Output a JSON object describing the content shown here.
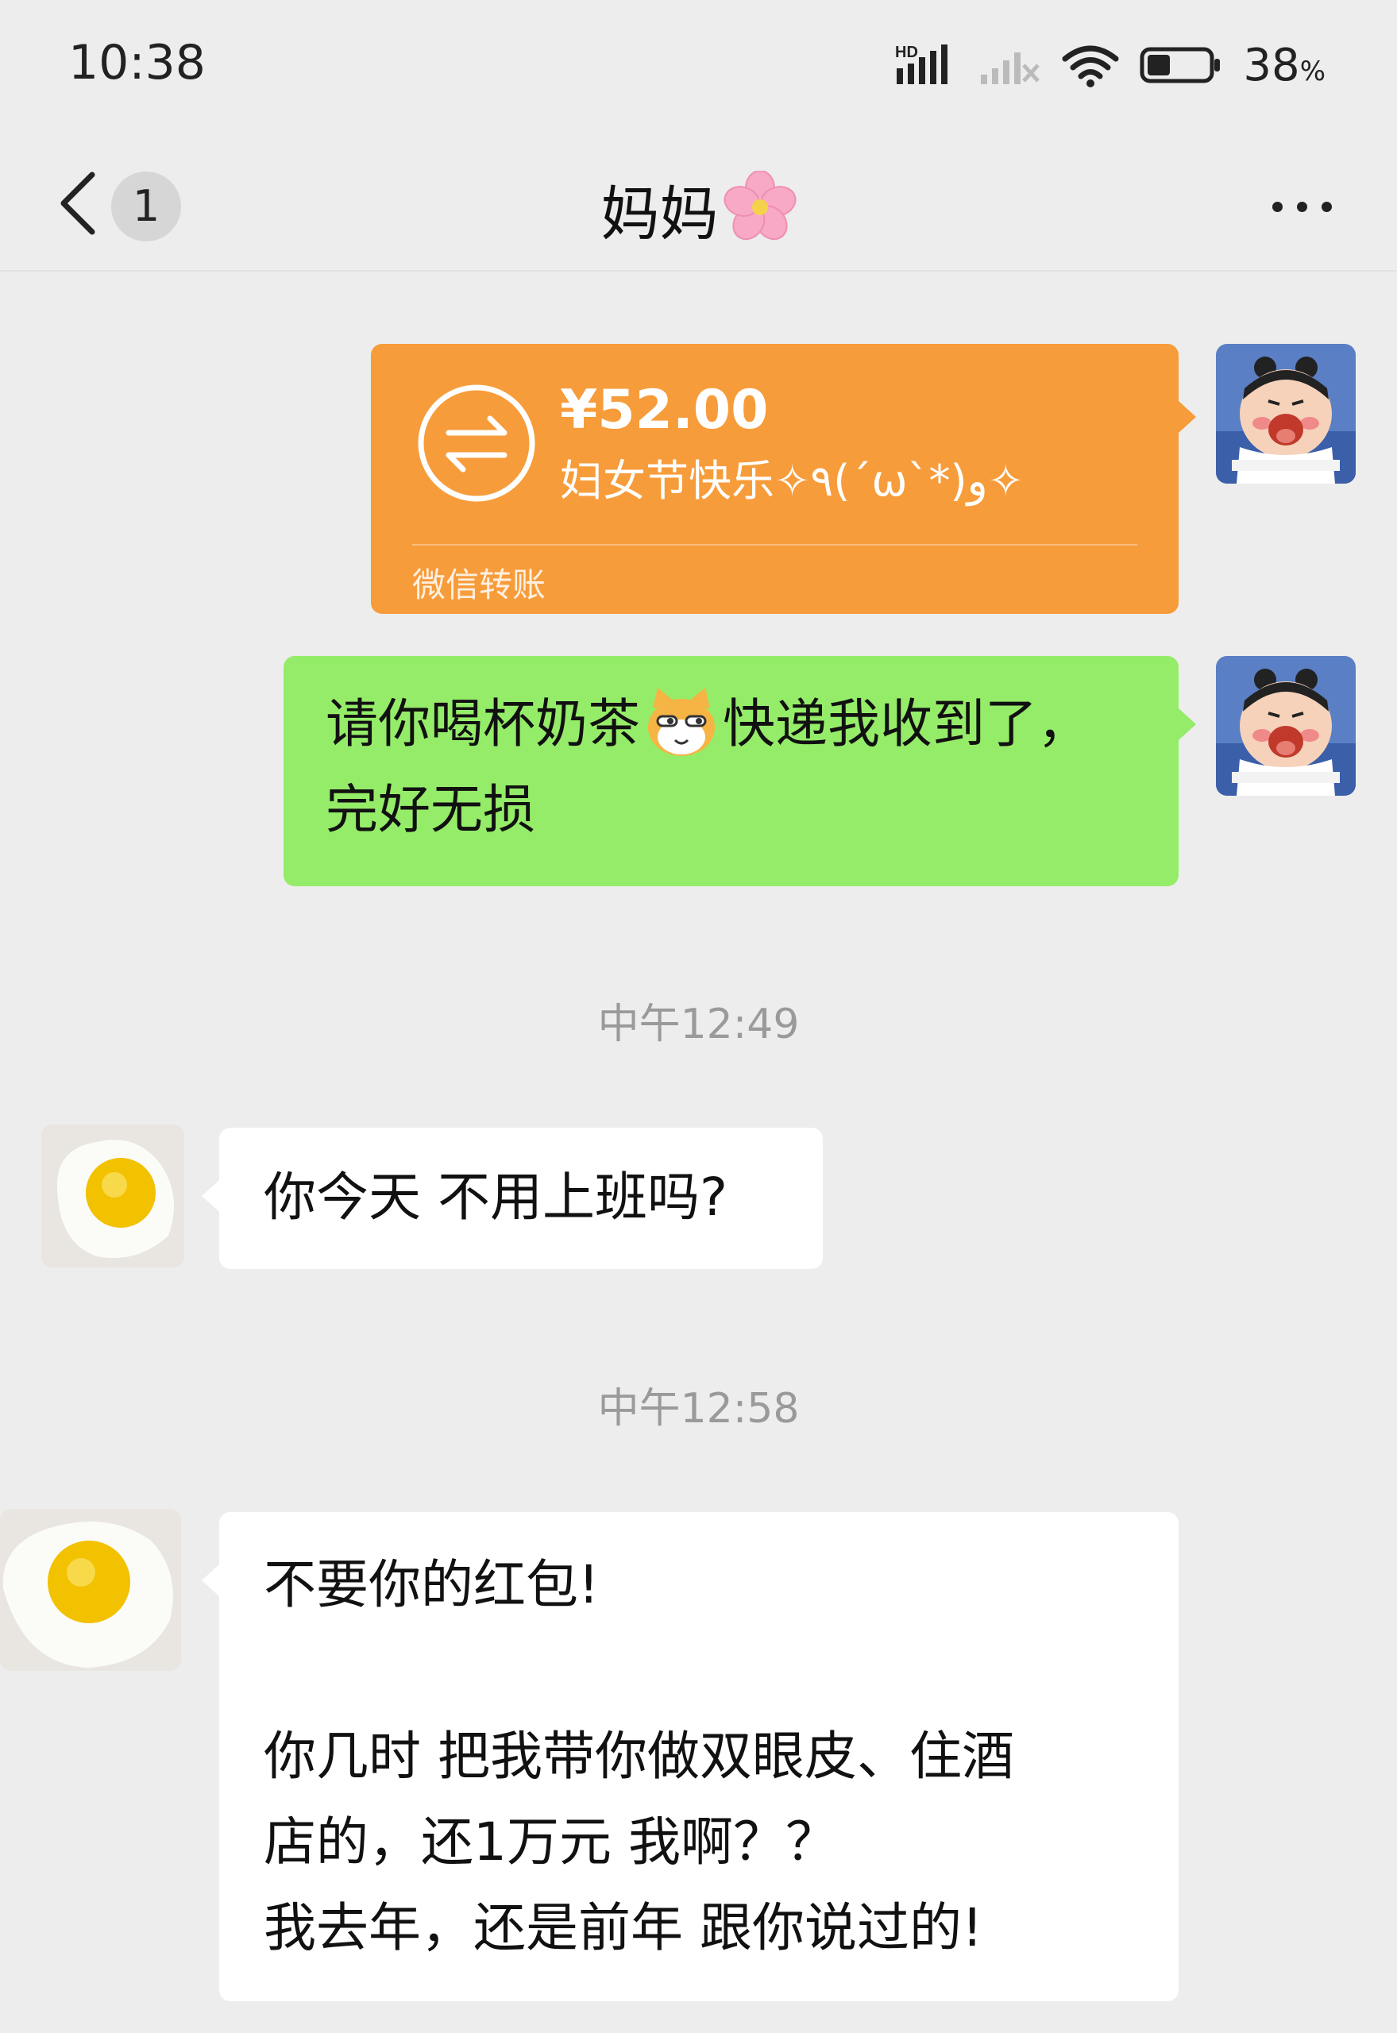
{
  "status_bar": {
    "time": "10:38",
    "network_label": "HD",
    "battery_percent": "38",
    "battery_unit": "%",
    "battery_level": 0.38
  },
  "nav": {
    "unread_count": "1",
    "title": "妈妈",
    "title_emoji": "flower-icon"
  },
  "messages": {
    "transfer": {
      "amount": "¥52.00",
      "memo": "妇女节快乐✧٩(ˊωˋ*)و✧",
      "footer": "微信转账",
      "color": "#f79c3a"
    },
    "me_text": {
      "part1": "请你喝杯奶茶",
      "emoji": "cat-emoji-icon",
      "part2": "快递我收到了，",
      "line2": "完好无损",
      "color": "#95ec69"
    },
    "time1": "中午12:49",
    "mom_text1": "你今天 不用上班吗?",
    "time2": "中午12:58",
    "mom_text2": {
      "line1": "不要你的红包!",
      "line2": "你几时 把我带你做双眼皮、住酒",
      "line3": "店的，还1万元 我啊？？",
      "line4": "我去年，还是前年 跟你说过的!"
    }
  }
}
